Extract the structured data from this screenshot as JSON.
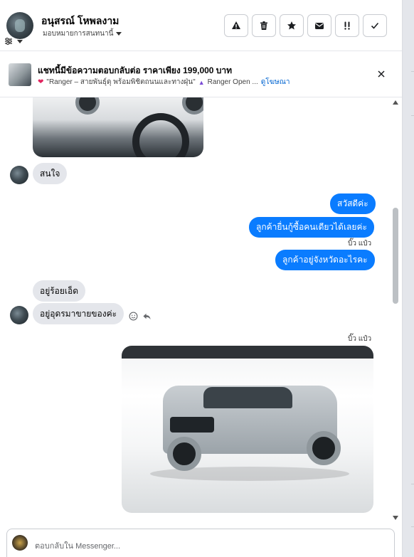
{
  "header": {
    "contact_name": "อนุสรณ์ โหพลงาม",
    "assign_label": "มอบหมายการสนทนานี้",
    "actions": [
      {
        "name": "report-button",
        "icon": "warning-icon"
      },
      {
        "name": "delete-button",
        "icon": "trash-icon"
      },
      {
        "name": "star-button",
        "icon": "star-icon"
      },
      {
        "name": "mark-unread-button",
        "icon": "envelope-icon"
      },
      {
        "name": "follow-up-button",
        "icon": "double-exclamation-icon"
      },
      {
        "name": "mark-done-button",
        "icon": "check-icon"
      }
    ]
  },
  "ad_banner": {
    "title": "แชทนี้มีข้อความตอบกลับต่อ ราคาเพียง 199,000 บาท",
    "subtitle": "\"Ranger – สายพันธุ์ดุ พร้อมพิชิตถนนและทางฝุ่น\"",
    "campaign": "Ranger Open ...",
    "link": "ดูโฆษณา"
  },
  "messages": {
    "m1": "สนใจ",
    "m2": "สวัสดีค่ะ",
    "m3": "ลูกค้ายื่นกู้ซื้อคนเดียวได้เลยค่ะ",
    "m4": "ลูกค้าอยู่จังหวัดอะไรคะ",
    "m5": "อยู่ร้อยเอ็ด",
    "m6": "อยู่อุดรมาขายของค่ะ"
  },
  "readers": {
    "r1": "บิ๊ว แป๋ว",
    "r2": "บิ๊ว แป๋ว"
  },
  "composer": {
    "placeholder": "ตอบกลับใน Messenger..."
  }
}
